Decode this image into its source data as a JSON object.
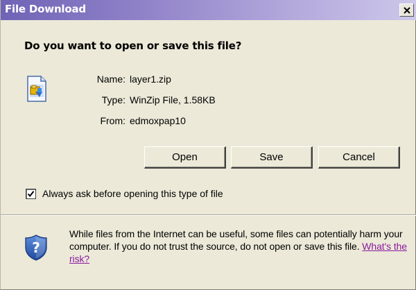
{
  "window": {
    "title": "File Download",
    "close_glyph": "×"
  },
  "question": "Do you want to open or save this file?",
  "file_info": {
    "name_label": "Name:",
    "name_value": "layer1.zip",
    "type_label": "Type:",
    "type_value": "WinZip File, 1.58KB",
    "from_label": "From:",
    "from_value": "edmoxpap10"
  },
  "buttons": {
    "open": "Open",
    "save": "Save",
    "cancel": "Cancel"
  },
  "checkbox": {
    "label": "Always ask before opening this type of file",
    "checked": true
  },
  "warning": {
    "text": "While files from the Internet can be useful, some files can potentially harm your computer. If you do not trust the source, do not open or save this file.",
    "link": "What's the risk?"
  },
  "icons": {
    "file": "zip-file-icon",
    "shield": "security-shield-question-icon",
    "close": "close-icon",
    "check": "check-icon"
  },
  "colors": {
    "titlebar_start": "#6f63b6",
    "titlebar_end": "#cdc7e9",
    "window_bg": "#ece9d8",
    "link": "#8a1aa0"
  }
}
